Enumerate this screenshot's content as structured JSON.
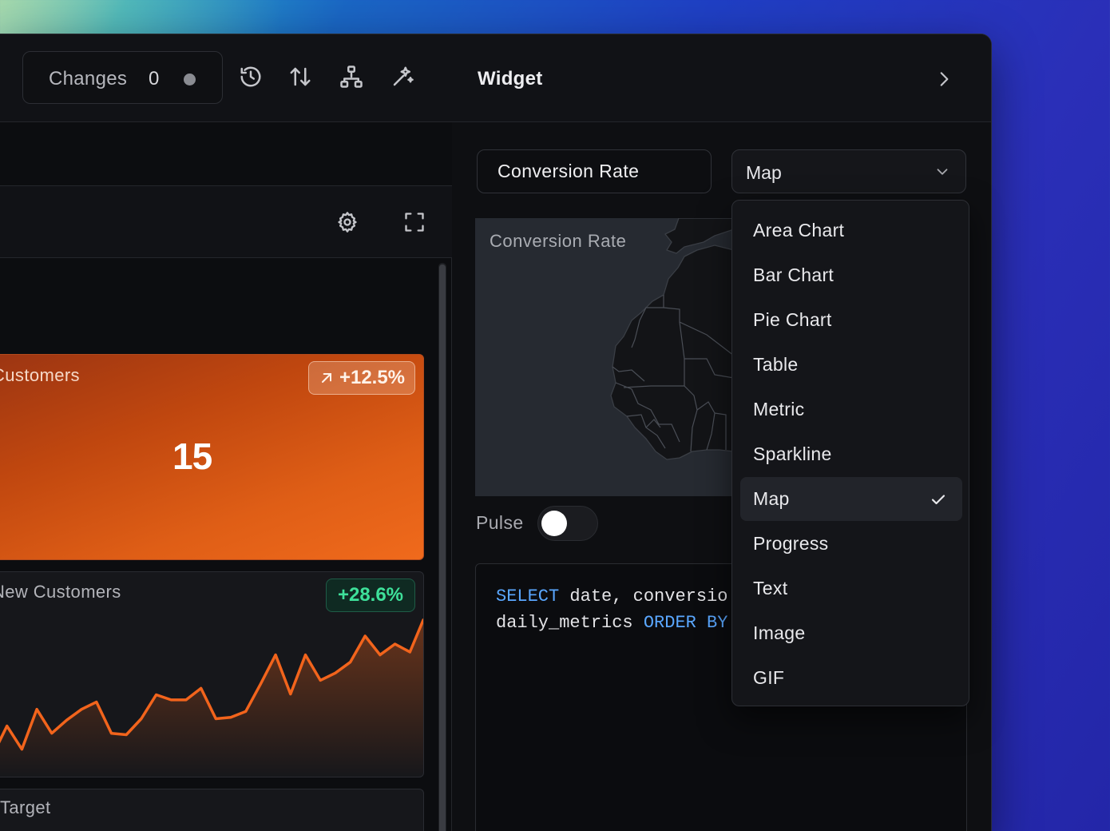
{
  "toolbar": {
    "changes_label": "Changes",
    "changes_count": "0",
    "icons": [
      "history-icon",
      "sort-arrows-icon",
      "sitemap-icon",
      "sparkles-icon"
    ]
  },
  "dashboard": {
    "toolrow_icons": [
      "gear-icon",
      "fullscreen-icon"
    ],
    "cards": [
      {
        "title": "Customers",
        "badge": "+12.5%",
        "value": "15",
        "badge_icon": "arrow-up-right-icon"
      },
      {
        "title": "New Customers",
        "badge": "+28.6%",
        "sparkline": [
          30,
          72,
          40,
          95,
          62,
          80,
          95,
          105,
          62,
          60,
          82,
          115,
          108,
          108,
          124,
          82,
          84,
          92,
          130,
          170,
          116,
          170,
          135,
          145,
          160,
          196,
          170,
          185,
          174,
          218
        ]
      },
      {
        "title": "Target"
      }
    ],
    "colors": {
      "orange_start": "#9c3512",
      "orange_end": "#f06a1c",
      "green": "#3ee09a",
      "line": "#f2641c"
    }
  },
  "panel": {
    "title": "Widget",
    "name_value": "Conversion Rate",
    "type_value": "Map",
    "preview_title": "Conversion Rate",
    "pulse_label": "Pulse",
    "pulse_on": false,
    "code_line1": [
      "SELECT",
      " date, conversio"
    ],
    "code_line2": [
      "daily_metrics ",
      "ORDER BY"
    ]
  },
  "dropdown": {
    "options": [
      "Area Chart",
      "Bar Chart",
      "Pie Chart",
      "Table",
      "Metric",
      "Sparkline",
      "Map",
      "Progress",
      "Text",
      "Image",
      "GIF"
    ],
    "selected": "Map"
  }
}
